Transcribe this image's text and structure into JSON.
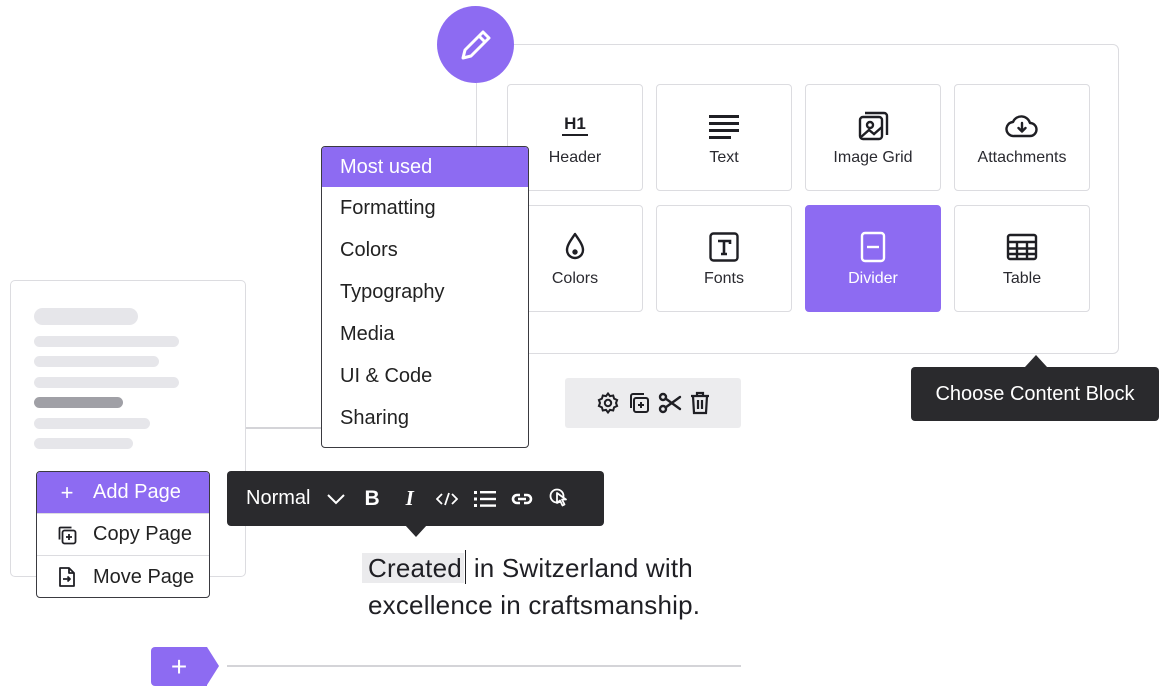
{
  "content_blocks": {
    "tiles": [
      {
        "label": "Header",
        "icon": "h1-icon",
        "glyph": "H1"
      },
      {
        "label": "Text",
        "icon": "text-align-icon"
      },
      {
        "label": "Image Grid",
        "icon": "image-grid-icon"
      },
      {
        "label": "Attachments",
        "icon": "cloud-download-icon"
      },
      {
        "label": "Colors",
        "icon": "droplet-icon"
      },
      {
        "label": "Fonts",
        "icon": "text-box-icon",
        "glyph": "T"
      },
      {
        "label": "Divider",
        "icon": "divider-icon",
        "active": true
      },
      {
        "label": "Table",
        "icon": "table-icon"
      }
    ],
    "tooltip": "Choose Content Block"
  },
  "category_menu": {
    "items": [
      "Most used",
      "Formatting",
      "Colors",
      "Typography",
      "Media",
      "UI & Code",
      "Sharing"
    ],
    "selected": "Most used"
  },
  "block_toolbar": {
    "icons": [
      "settings-icon",
      "duplicate-icon",
      "scissors-icon",
      "trash-icon"
    ]
  },
  "page_menu": {
    "items": [
      {
        "label": "Add Page",
        "icon": "plus-icon",
        "glyph": "+"
      },
      {
        "label": "Copy Page",
        "icon": "copy-page-icon"
      },
      {
        "label": "Move Page",
        "icon": "move-page-icon"
      }
    ],
    "selected": "Add Page"
  },
  "format_toolbar": {
    "style_value": "Normal",
    "bold_glyph": "B",
    "italic_glyph": "I"
  },
  "editor": {
    "selected_word": "Created",
    "line1_rest": " in Switzerland with",
    "line2": "excellence in craftsmanship."
  },
  "add_block": {
    "glyph": "+"
  },
  "colors": {
    "accent": "#8d6bf2",
    "dark": "#2a2a2d",
    "border": "#dcdce0"
  }
}
